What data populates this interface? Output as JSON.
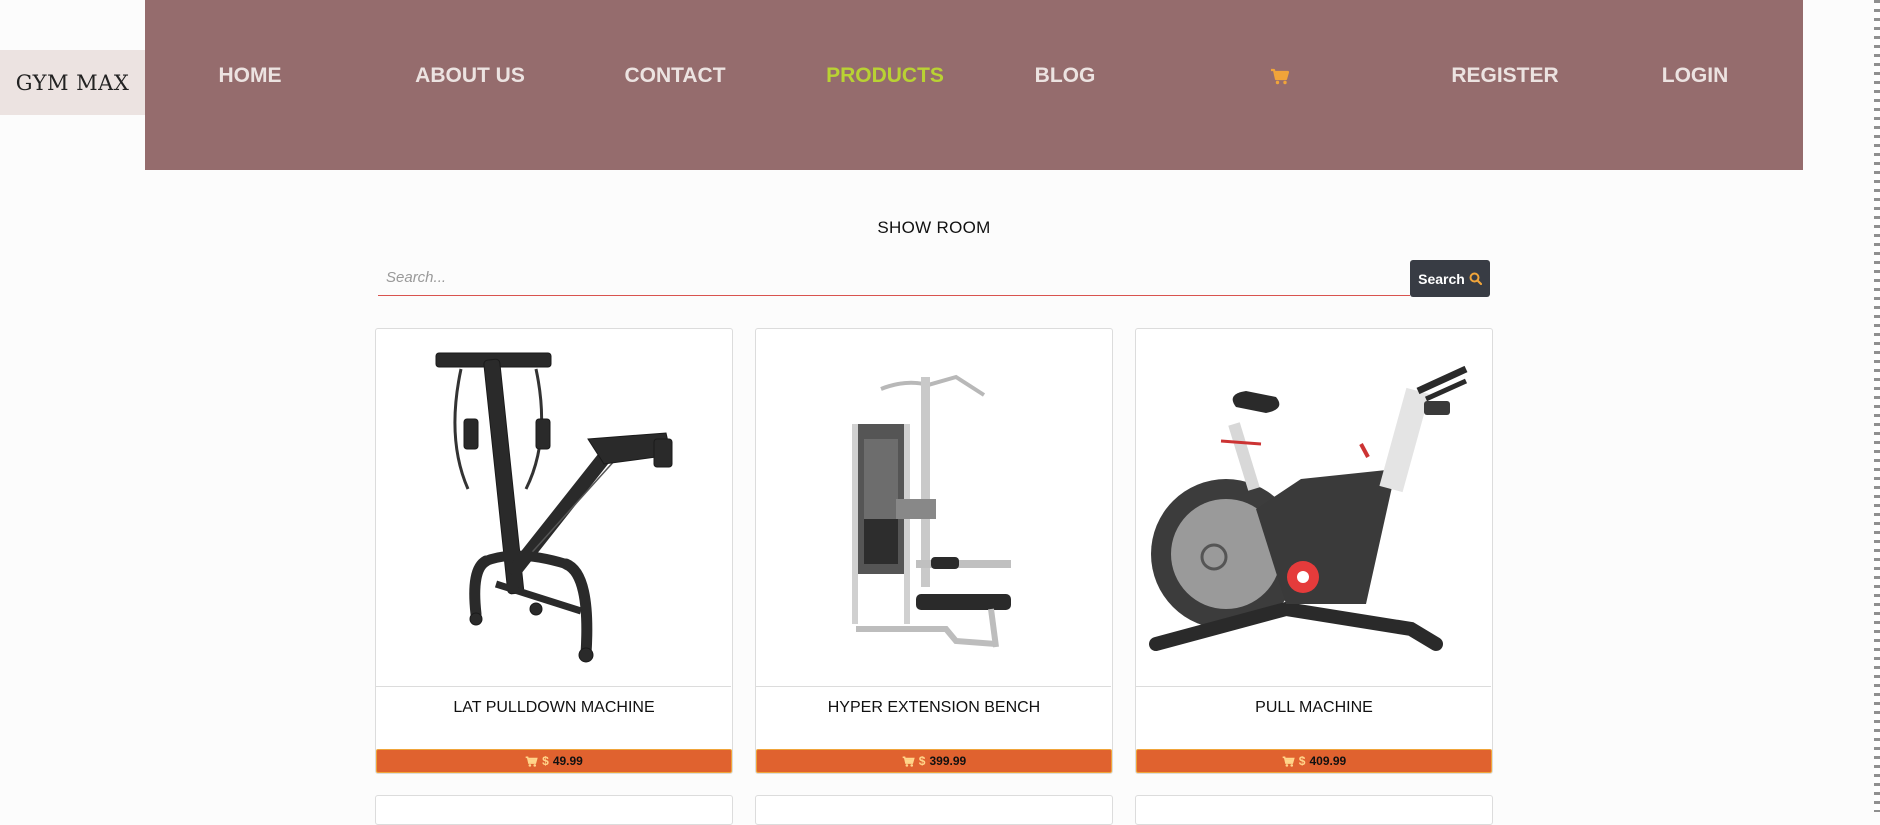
{
  "brand": "GYM MAX",
  "nav": {
    "home": "HOME",
    "about": "ABOUT US",
    "contact": "CONTACT",
    "products": "PRODUCTS",
    "blog": "BLOG",
    "cart_icon": "cart-icon",
    "register": "REGISTER",
    "login": "LOGIN"
  },
  "colors": {
    "navbar_bg": "#956c6d",
    "brand_bg": "#ece3e1",
    "active_link": "#b9d233",
    "price_bar": "#e0622f",
    "search_button": "#383c44"
  },
  "section_title": "SHOW ROOM",
  "search": {
    "placeholder": "Search...",
    "button_label": "Search",
    "button_icon": "search-icon"
  },
  "products": [
    {
      "name": "LAT PULLDOWN MACHINE",
      "currency": "$",
      "price": "49.99"
    },
    {
      "name": "HYPER EXTENSION BENCH",
      "currency": "$",
      "price": "399.99"
    },
    {
      "name": "PULL MACHINE",
      "currency": "$",
      "price": "409.99"
    }
  ]
}
